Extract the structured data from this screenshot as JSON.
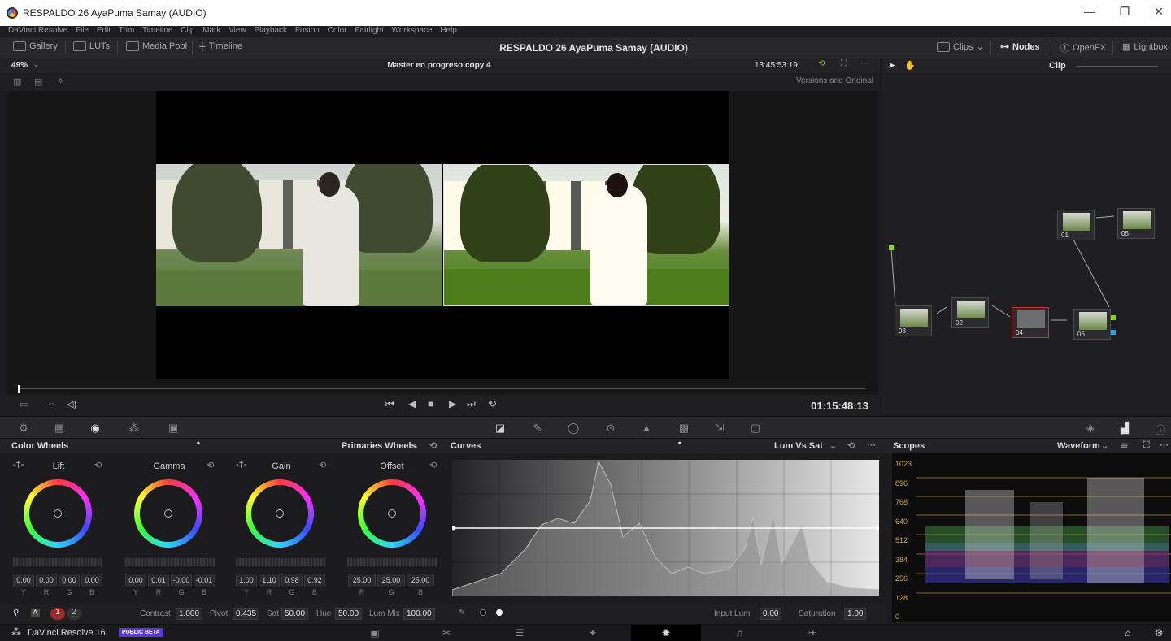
{
  "window": {
    "title": "RESPALDO 26 AyaPuma Samay (AUDIO)",
    "minimize": "—",
    "maximize": "❐",
    "close": "✕"
  },
  "menu": [
    "DaVinci Resolve",
    "File",
    "Edit",
    "Trim",
    "Timeline",
    "Clip",
    "Mark",
    "View",
    "Playback",
    "Fusion",
    "Color",
    "Fairlight",
    "Workspace",
    "Help"
  ],
  "toolbar": {
    "gallery": "Gallery",
    "luts": "LUTs",
    "media_pool": "Media Pool",
    "timeline": "Timeline",
    "project_title": "RESPALDO 26 AyaPuma Samay (AUDIO)",
    "clips": "Clips",
    "nodes": "Nodes",
    "openfx": "OpenFX",
    "lightbox": "Lightbox"
  },
  "viewer": {
    "zoom": "49%",
    "timeline_name": "Master en progreso copy 4",
    "timecode_top": "13:45:53:19",
    "versions": "Versions and Original",
    "timecode": "01:15:48:13"
  },
  "node_panel": {
    "mode": "Clip",
    "nodes": [
      {
        "label": "01"
      },
      {
        "label": "05"
      },
      {
        "label": "02"
      },
      {
        "label": "03"
      },
      {
        "label": "04"
      },
      {
        "label": "06"
      }
    ]
  },
  "color_wheels": {
    "title": "Color Wheels",
    "mode": "Primaries Wheels",
    "wheels": [
      {
        "name": "Lift",
        "values": [
          "0.00",
          "0.00",
          "0.00",
          "0.00"
        ],
        "channels": [
          "Y",
          "R",
          "G",
          "B"
        ]
      },
      {
        "name": "Gamma",
        "values": [
          "0.00",
          "0.01",
          "-0.00",
          "-0.01"
        ],
        "channels": [
          "Y",
          "R",
          "G",
          "B"
        ]
      },
      {
        "name": "Gain",
        "values": [
          "1.00",
          "1.10",
          "0.98",
          "0.92"
        ],
        "channels": [
          "Y",
          "R",
          "G",
          "B"
        ]
      },
      {
        "name": "Offset",
        "values": [
          "25.00",
          "25.00",
          "25.00"
        ],
        "channels": [
          "R",
          "G",
          "B"
        ]
      }
    ],
    "contrast_label": "Contrast",
    "contrast": "1.000",
    "pivot_label": "Pivot",
    "pivot": "0.435",
    "sat_label": "Sat",
    "sat": "50.00",
    "hue_label": "Hue",
    "hue": "50.00",
    "lummix_label": "Lum Mix",
    "lummix": "100.00",
    "page1": "1",
    "page2": "2"
  },
  "curves": {
    "title": "Curves",
    "mode": "Lum Vs Sat",
    "input_lum_label": "Input Lum",
    "input_lum": "0.00",
    "saturation_label": "Saturation",
    "saturation": "1.00"
  },
  "scopes": {
    "title": "Scopes",
    "mode": "Waveform",
    "scale": [
      "1023",
      "896",
      "768",
      "640",
      "512",
      "384",
      "256",
      "128",
      "0"
    ]
  },
  "footer": {
    "app": "DaVinci Resolve 16",
    "badge": "PUBLIC BETA"
  }
}
